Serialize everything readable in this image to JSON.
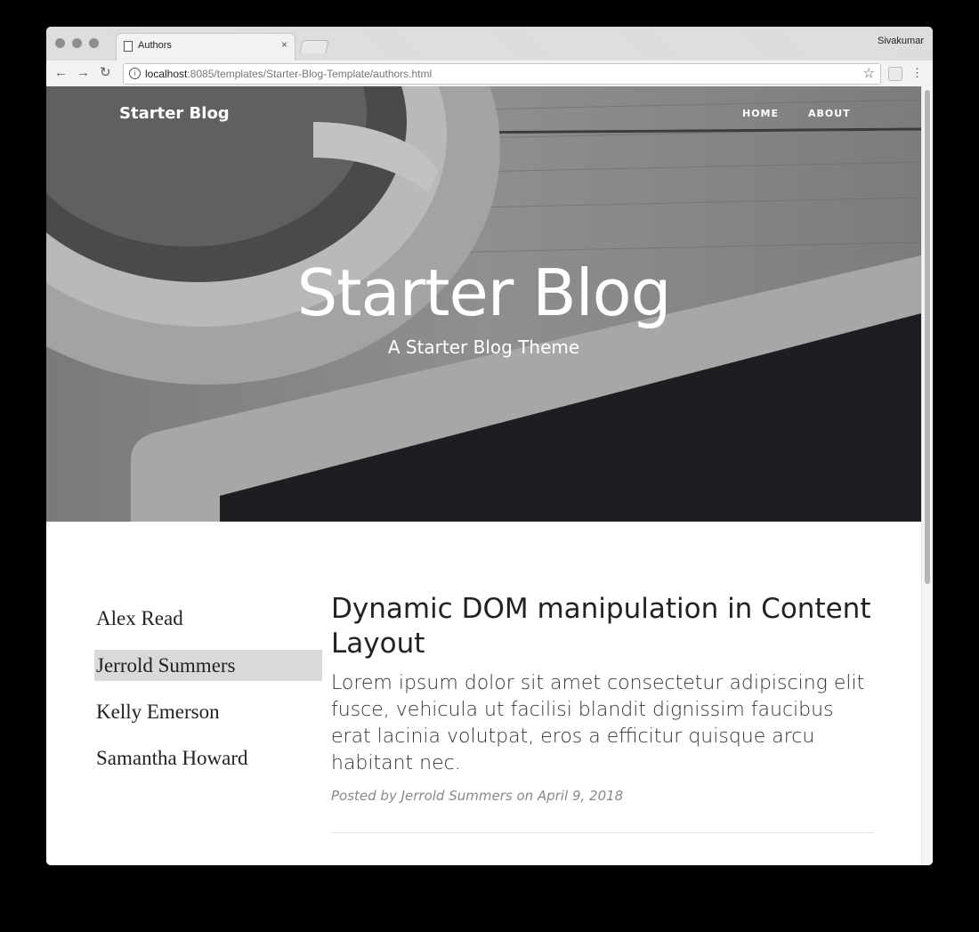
{
  "browser": {
    "tab_title": "Authors",
    "tab_close": "×",
    "user": "Sivakumar",
    "url_host": "localhost",
    "url_path": ":8085/templates/Starter-Blog-Template/authors.html",
    "back_icon": "←",
    "forward_icon": "→",
    "reload_icon": "↻",
    "star_icon": "☆",
    "menu_icon": "⋮",
    "info_icon": "i"
  },
  "site": {
    "brand": "Starter Blog",
    "nav": [
      "HOME",
      "ABOUT"
    ],
    "hero_title": "Starter Blog",
    "hero_subtitle": "A Starter Blog Theme"
  },
  "authors": {
    "items": [
      "Alex Read",
      "Jerrold Summers",
      "Kelly Emerson",
      "Samantha Howard"
    ],
    "active": "Jerrold Summers"
  },
  "post": {
    "title": "Dynamic DOM manipulation in Content Layout",
    "excerpt": "Lorem ipsum dolor sit amet consectetur adipiscing elit fusce, vehicula ut facilisi blandit dignissim faucibus erat lacinia volutpat, eros a efficitur quisque arcu habitant nec.",
    "meta": "Posted by Jerrold Summers on April 9, 2018"
  }
}
